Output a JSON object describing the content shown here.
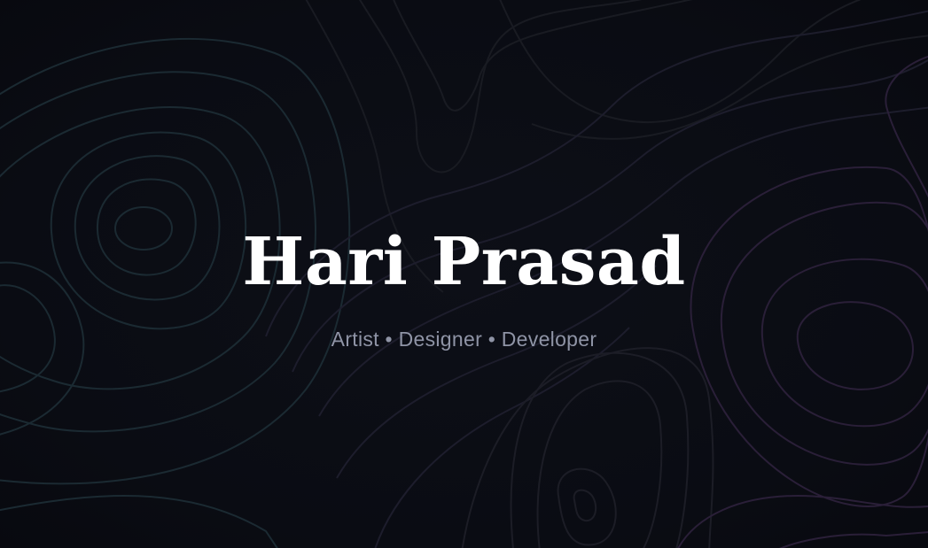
{
  "hero": {
    "name": "Hari Prasad",
    "tagline": "Artist • Designer • Developer"
  },
  "colors": {
    "background": "#0b0d14",
    "name_text": "#ffffff",
    "tagline_text": "#8f94a6",
    "contour_teal": "#1c2b33",
    "contour_purple": "#2a1f38",
    "contour_neutral": "#1a1c24"
  }
}
